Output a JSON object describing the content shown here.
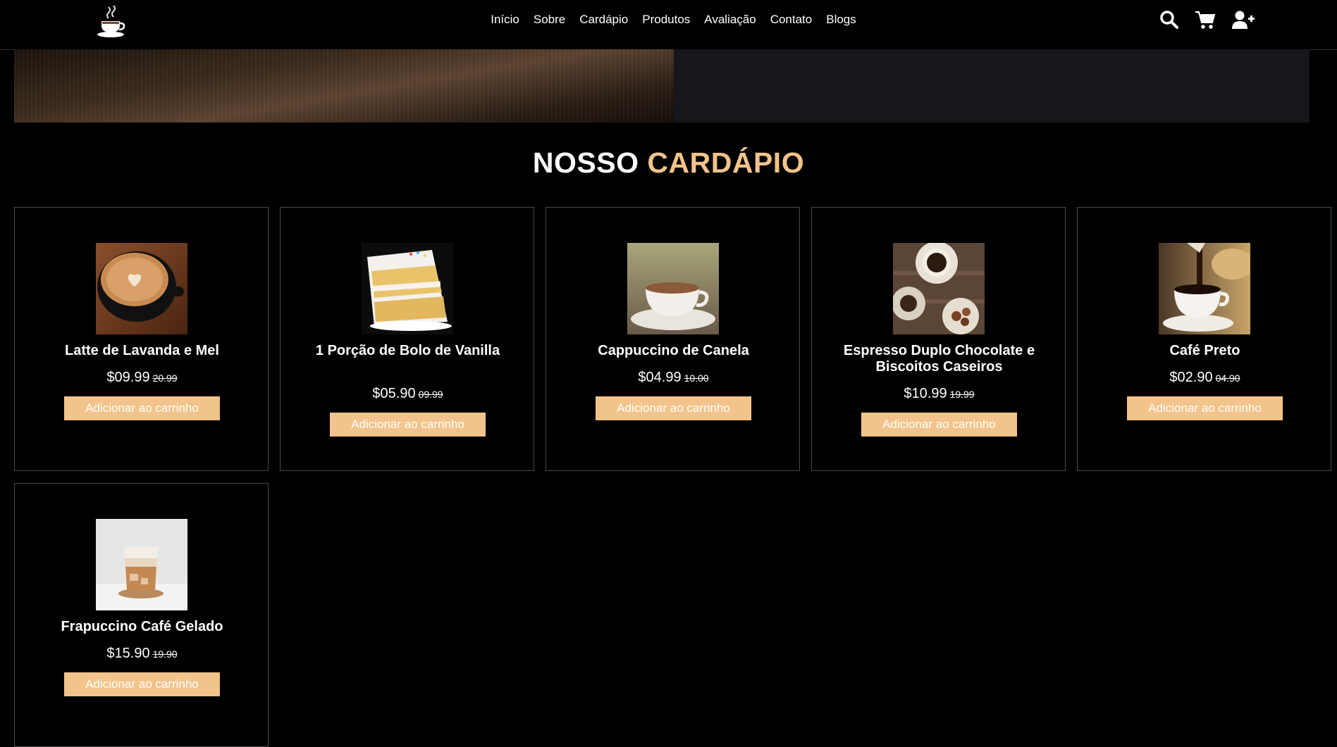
{
  "nav": {
    "items": [
      "Início",
      "Sobre",
      "Cardápio",
      "Produtos",
      "Avaliação",
      "Contato",
      "Blogs"
    ]
  },
  "icons": {
    "logo": "coffee-cup-icon",
    "search": "search-icon",
    "cart": "shopping-cart-icon",
    "user": "user-plus-icon"
  },
  "section": {
    "title_main": "NOSSO",
    "title_accent": "CARDÁPIO"
  },
  "colors": {
    "accent": "#f2c38a",
    "background": "#000000",
    "card_border": "#4a4a4a"
  },
  "products": [
    {
      "name": "Latte de Lavanda e Mel",
      "price": "$09.99",
      "old_price": "20.99",
      "button": "Adicionar ao carrinho"
    },
    {
      "name": "1 Porção de Bolo de Vanilla",
      "price": "$05.90",
      "old_price": "09.99",
      "button": "Adicionar ao carrinho"
    },
    {
      "name": "Cappuccino de Canela",
      "price": "$04.99",
      "old_price": "10.00",
      "button": "Adicionar ao carrinho"
    },
    {
      "name": "Espresso Duplo Chocolate e Biscoitos Caseiros",
      "price": "$10.99",
      "old_price": "19.99",
      "button": "Adicionar ao carrinho"
    },
    {
      "name": "Café Preto",
      "price": "$02.90",
      "old_price": "04.90",
      "button": "Adicionar ao carrinho"
    },
    {
      "name": "Frapuccino Café Gelado",
      "price": "$15.90",
      "old_price": "19.90",
      "button": "Adicionar ao carrinho"
    }
  ]
}
